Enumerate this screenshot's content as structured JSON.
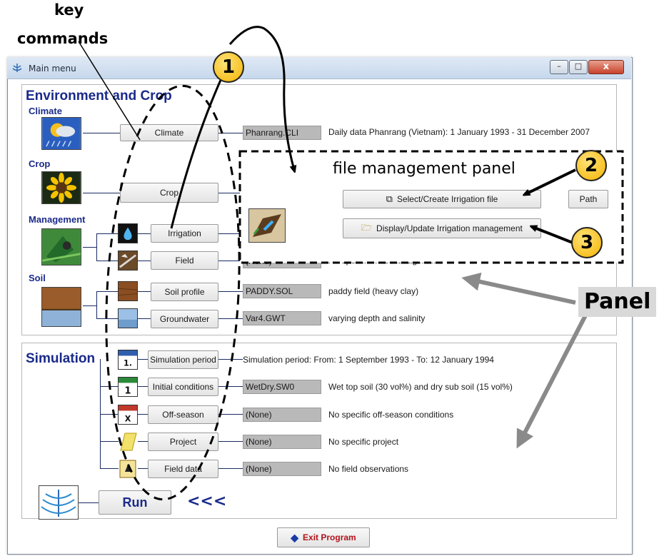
{
  "annotations": {
    "key_commands_line1": "key",
    "key_commands_line2": "commands",
    "file_panel_label": "file management panel",
    "panel_label": "Panel",
    "callout1": "1",
    "callout2": "2",
    "callout3": "3",
    "run_arrows": "<<<"
  },
  "window": {
    "title": "Main menu",
    "minimize": "–",
    "maximize": "□",
    "close": "x"
  },
  "env": {
    "heading": "Environment and Crop",
    "climate": {
      "section": "Climate",
      "button": "Climate",
      "file": "Phanrang.CLI",
      "description": "Daily data Phanrang (Vietnam): 1 January 1993 - 31 December 2007"
    },
    "crop": {
      "section": "Crop",
      "button": "Crop"
    },
    "management": {
      "section": "Management",
      "irrigation_button": "Irrigation",
      "field_button": "Field",
      "field_file": "(None)",
      "field_description": "No specific field management",
      "select_button": "Select/Create Irrigation file",
      "path_button": "Path",
      "display_button": "Display/Update Irrigation management"
    },
    "soil": {
      "section": "Soil",
      "profile_button": "Soil profile",
      "profile_file": "PADDY.SOL",
      "profile_description": "paddy field (heavy clay)",
      "groundwater_button": "Groundwater",
      "groundwater_file": "Var4.GWT",
      "groundwater_description": "varying depth and salinity"
    }
  },
  "sim": {
    "heading": "Simulation",
    "period_button": "Simulation period",
    "period_description": "Simulation period: From: 1 September 1993 - To: 12 January 1994",
    "initial_button": "Initial conditions",
    "initial_file": "WetDry.SW0",
    "initial_description": "Wet top soil (30 vol%) and dry sub soil (15 vol%)",
    "offseason_button": "Off-season",
    "offseason_file": "(None)",
    "offseason_description": "No specific off-season conditions",
    "project_button": "Project",
    "project_file": "(None)",
    "project_description": "No specific project",
    "fielddata_button": "Field data",
    "fielddata_file": "(None)",
    "fielddata_description": "No field observations",
    "run_button": "Run",
    "calendar_day": "1",
    "calendar_tab": "1.",
    "offseason_mark": "X"
  },
  "footer": {
    "exit_button": "Exit Program"
  },
  "colors": {
    "heading": "#1a2a8a",
    "field_bg": "#b9b9b9",
    "callout": "#f4b400"
  }
}
